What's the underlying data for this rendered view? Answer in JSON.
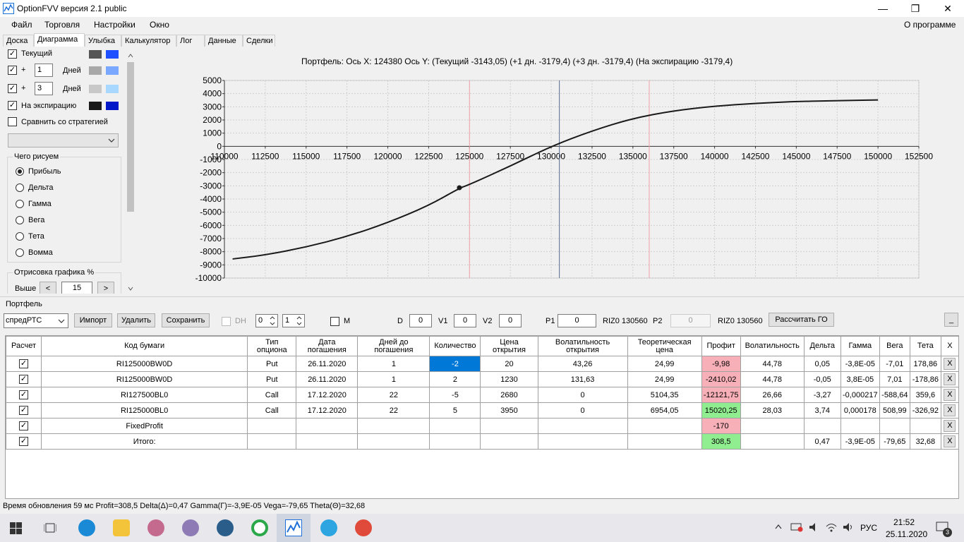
{
  "window": {
    "title": "OptionFVV версия 2.1 public",
    "minimize": "—",
    "maximize": "❐",
    "close": "✕"
  },
  "menu": {
    "file": "Файл",
    "trade": "Торговля",
    "settings": "Настройки",
    "window": "Окно",
    "about": "О программе"
  },
  "tabs": [
    "Доска",
    "Диаграмма",
    "Улыбка",
    "Калькулятор",
    "Лог",
    "Данные",
    "Сделки"
  ],
  "left": {
    "current": "Текущий",
    "plus": "+",
    "days1": "1",
    "days2": "3",
    "days_label": "Дней",
    "expiration": "На экспирацию",
    "compare": "Сравнить со стратегией",
    "draw_group": "Чего рисуем",
    "radios": [
      "Прибыль",
      "Дельта",
      "Гамма",
      "Вега",
      "Тета",
      "Вомма"
    ],
    "render_group": "Отрисовка графика %",
    "above": "Выше",
    "above_value": "15",
    "prev": "<",
    "next": ">",
    "colors": {
      "current_a": "#555555",
      "current_b": "#1e50ff",
      "plus1_a": "#a8a8a8",
      "plus1_b": "#7aa8ff",
      "plus3_a": "#c8c8c8",
      "plus3_b": "#a8d8ff",
      "exp_a": "#1a1a1a",
      "exp_b": "#0018c8"
    }
  },
  "chart_header": "Портфель: Ось X: 124380 Ось Y:  (Текущий -3143,05)  (+1 дн. -3179,4)  (+3 дн. -3179,4)  (На экспирацию -3179,4)",
  "chart_data": {
    "type": "line",
    "title": "Портфель: Ось X: 124380 Ось Y:  (Текущий -3143,05)  (+1 дн. -3179,4)  (+3 дн. -3179,4)  (На экспирацию -3179,4)",
    "xlim": [
      110000,
      152500
    ],
    "ylim": [
      -10000,
      5000
    ],
    "x_ticks": [
      "110000",
      "112500",
      "115000",
      "117500",
      "120000",
      "122500",
      "125000",
      "127500",
      "130000",
      "132500",
      "135000",
      "137500",
      "140000",
      "142500",
      "145000",
      "147500",
      "150000",
      "152500"
    ],
    "y_ticks": [
      "5000",
      "4000",
      "3000",
      "2000",
      "1000",
      "0",
      "-1000",
      "-2000",
      "-3000",
      "-4000",
      "-5000",
      "-6000",
      "-7000",
      "-8000",
      "-9000",
      "-10000"
    ],
    "grid": true,
    "series": [
      {
        "x": [
          110500,
          112500,
          115000,
          117500,
          120000,
          122500,
          124380,
          125000,
          127500,
          130000,
          132500,
          135000,
          137500,
          140000,
          142500,
          145000,
          147500,
          150000
        ],
        "y": [
          -8550,
          -8250,
          -7650,
          -6850,
          -5800,
          -4500,
          -3180,
          -2900,
          -1500,
          0,
          1180,
          2130,
          2700,
          3050,
          3270,
          3400,
          3470,
          3520
        ]
      }
    ],
    "marker": {
      "x": 124380,
      "y": -3143
    },
    "vlines": [
      {
        "x": 125000,
        "color": "#f0a0a8"
      },
      {
        "x": 130500,
        "color": "#5a6a90"
      },
      {
        "x": 136000,
        "color": "#f0a0a8"
      }
    ]
  },
  "portfolio": {
    "group": "Портфель",
    "portfolio_select": "спредРТС",
    "import": "Импорт",
    "delete": "Удалить",
    "save": "Сохранить",
    "dh": "DH",
    "spin1": "0",
    "spin2": "1",
    "m": "M",
    "d_label": "D",
    "d_value": "0",
    "v1_label": "V1",
    "v1_value": "0",
    "v2_label": "V2",
    "v2_value": "0",
    "p1_label": "P1",
    "p1_value": "0",
    "p1_inst": "RIZ0 130560",
    "p2_label": "P2",
    "p2_value": "0",
    "p2_inst": "RIZ0 130560",
    "calc": "Рассчитать ГО",
    "collapse": "_",
    "headers": [
      "Расчет",
      "Код бумаги",
      "Тип опциона",
      "Дата погашения",
      "Дней до погашения",
      "Количество",
      "Цена открытия",
      "Волатильность открытия",
      "Теоретическая цена",
      "Профит",
      "Волатильность",
      "Дельта",
      "Гамма",
      "Вега",
      "Тета",
      "X"
    ],
    "rows": [
      [
        "✓",
        "RI125000BW0D",
        "Put",
        "26.11.2020",
        "1",
        "-2",
        "20",
        "43,26",
        "24,99",
        "-9,98",
        "44,78",
        "0,05",
        "-3,8E-05",
        "-7,01",
        "178,86",
        "X"
      ],
      [
        "✓",
        "RI125000BW0D",
        "Put",
        "26.11.2020",
        "1",
        "2",
        "1230",
        "131,63",
        "24,99",
        "-2410,02",
        "44,78",
        "-0,05",
        "3,8E-05",
        "7,01",
        "-178,86",
        "X"
      ],
      [
        "✓",
        "RI127500BL0",
        "Call",
        "17.12.2020",
        "22",
        "-5",
        "2680",
        "0",
        "5104,35",
        "-12121,75",
        "26,66",
        "-3,27",
        "-0,000217",
        "-588,64",
        "359,6",
        "X"
      ],
      [
        "✓",
        "RI125000BL0",
        "Call",
        "17.12.2020",
        "22",
        "5",
        "3950",
        "0",
        "6954,05",
        "15020,25",
        "28,03",
        "3,74",
        "0,000178",
        "508,99",
        "-326,92",
        "X"
      ],
      [
        "✓",
        "FixedProfit",
        "",
        "",
        "",
        "",
        "",
        "",
        "",
        "-170",
        "",
        "",
        "",
        "",
        "",
        "X"
      ],
      [
        "✓",
        "Итого:",
        "",
        "",
        "",
        "",
        "",
        "",
        "",
        "308,5",
        "",
        "0,47",
        "-3,9E-05",
        "-79,65",
        "32,68",
        "X"
      ]
    ]
  },
  "status": "Время обновления 59 мс  Profit=308,5 Delta(Δ)=0,47 Gamma(Γ)=-3,9E-05 Vega=-79,65 Theta(Θ)=32,68",
  "taskbar": {
    "lang": "РУС",
    "time": "21:52",
    "date": "25.11.2020",
    "notif": "3"
  }
}
